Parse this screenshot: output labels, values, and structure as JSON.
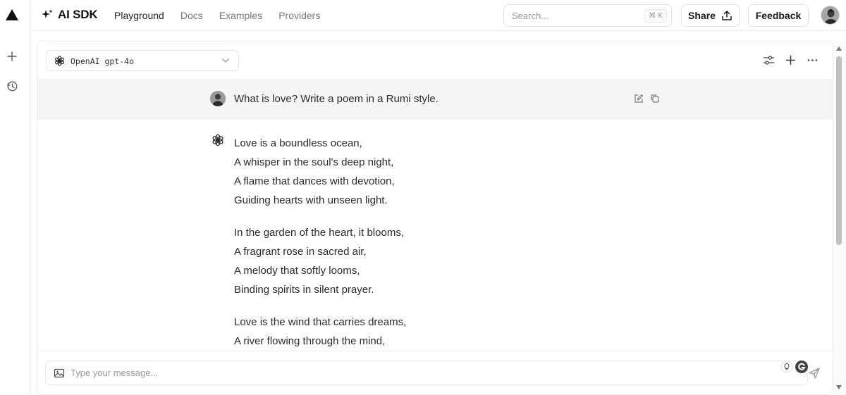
{
  "app": {
    "brand": "AI SDK",
    "nav": [
      "Playground",
      "Docs",
      "Examples",
      "Providers"
    ],
    "active_nav": "Playground",
    "search_placeholder": "Search...",
    "search_shortcut": "⌘ K",
    "share_label": "Share",
    "feedback_label": "Feedback"
  },
  "model": {
    "label": "OpenAI gpt-4o"
  },
  "conversation": {
    "user_message": "What is love? Write a poem in a Rumi style.",
    "assistant_stanzas": [
      [
        "Love is a boundless ocean,",
        "A whisper in the soul's deep night,",
        "A flame that dances with devotion,",
        "Guiding hearts with unseen light."
      ],
      [
        "In the garden of the heart, it blooms,",
        "A fragrant rose in sacred air,",
        "A melody that softly looms,",
        "Binding spirits in silent prayer."
      ],
      [
        "Love is the wind that carries dreams,",
        "A river flowing through the mind,"
      ]
    ]
  },
  "composer": {
    "placeholder": "Type your message..."
  },
  "colors": {
    "user_row_bg": "#f5f5f5",
    "border": "#ececec",
    "text_muted": "#777777"
  },
  "icons": [
    "triangle-logo-icon",
    "sparkle-icon",
    "plus-icon",
    "history-icon",
    "upload-icon",
    "openai-icon",
    "chevron-down-icon",
    "sliders-icon",
    "more-icon",
    "edit-icon",
    "copy-icon",
    "image-icon",
    "send-icon"
  ]
}
